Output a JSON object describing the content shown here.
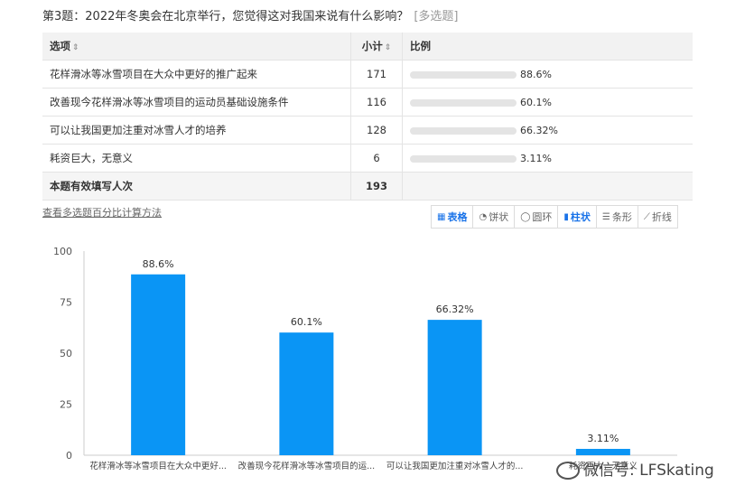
{
  "question": {
    "title": "第3题：2022年冬奥会在北京举行，您觉得这对我国来说有什么影响？",
    "tag": "[多选题]"
  },
  "table": {
    "headers": {
      "option": "选项",
      "count": "小计",
      "ratio": "比例"
    },
    "rows": [
      {
        "option": "花样滑冰等冰雪项目在大众中更好的推广起来",
        "count": "171",
        "pct": "88.6%",
        "fraction": 0.886
      },
      {
        "option": "改善现今花样滑冰等冰雪项目的运动员基础设施条件",
        "count": "116",
        "pct": "60.1%",
        "fraction": 0.601
      },
      {
        "option": "可以让我国更加注重对冰雪人才的培养",
        "count": "128",
        "pct": "66.32%",
        "fraction": 0.6632
      },
      {
        "option": "耗资巨大，无意义",
        "count": "6",
        "pct": "3.11%",
        "fraction": 0.0311
      }
    ],
    "total_label": "本题有效填写人次",
    "total_count": "193"
  },
  "calc_link": "查看多选题百分比计算方法",
  "toolbar": [
    {
      "icon": "table-icon",
      "label": "表格",
      "active": true
    },
    {
      "icon": "pie-icon",
      "label": "饼状",
      "active": false
    },
    {
      "icon": "ring-icon",
      "label": "圆环",
      "active": false
    },
    {
      "icon": "column-icon",
      "label": "柱状",
      "active": true
    },
    {
      "icon": "bar-icon",
      "label": "条形",
      "active": false
    },
    {
      "icon": "line-icon",
      "label": "折线",
      "active": false
    }
  ],
  "chart_data": {
    "type": "bar",
    "categories": [
      "花样滑冰等冰雪项目在大众中更好...",
      "改善现今花样滑冰等冰雪项目的运...",
      "可以让我国更加注重对冰雪人才的...",
      "耗资巨大，无意义"
    ],
    "values": [
      88.6,
      60.1,
      66.32,
      3.11
    ],
    "data_labels": [
      "88.6%",
      "60.1%",
      "66.32%",
      "3.11%"
    ],
    "yticks": [
      "0",
      "25",
      "50",
      "75",
      "100"
    ],
    "ylim": [
      0,
      100
    ],
    "bar_color": "#0a95f5",
    "grid": false
  },
  "watermark": "微信号: LFSkating"
}
